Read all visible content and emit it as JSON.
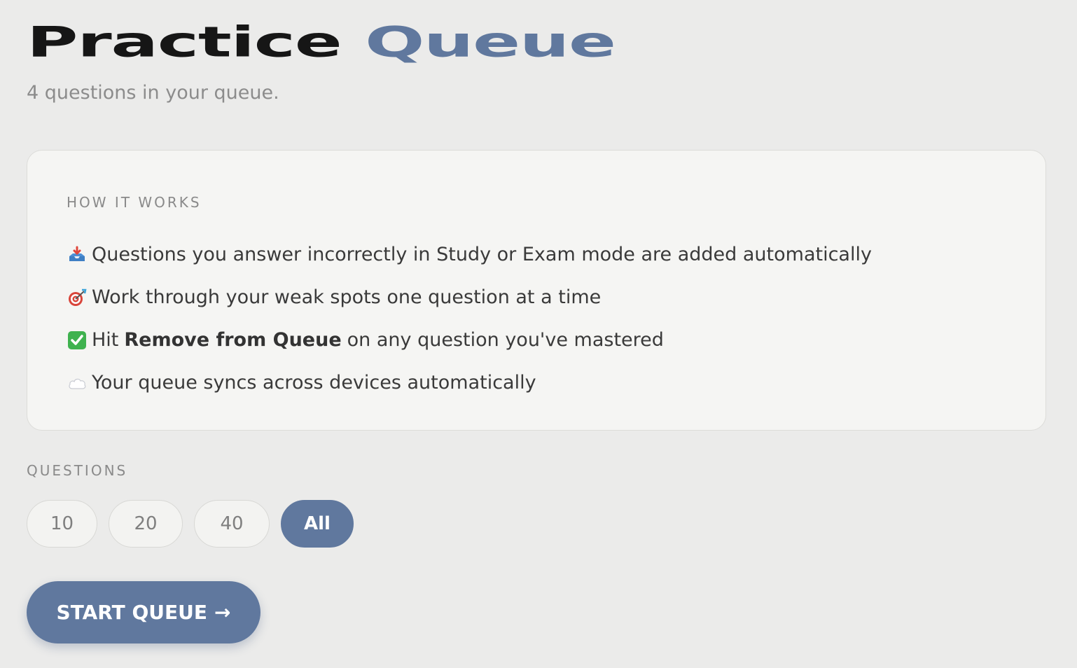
{
  "header": {
    "title_main": "Practice",
    "title_accent": "Queue",
    "subtitle": "4 questions in your queue."
  },
  "how_it_works": {
    "heading": "HOW IT WORKS",
    "items": [
      {
        "icon": "inbox-tray-icon",
        "text": "Questions you answer incorrectly in Study or Exam mode are added automatically"
      },
      {
        "icon": "direct-hit-icon",
        "text": "Work through your weak spots one question at a time"
      },
      {
        "icon": "check-mark-icon",
        "text_before": "Hit",
        "bold": "Remove from Queue",
        "text_after": "on any question you've mastered"
      },
      {
        "icon": "cloud-icon",
        "text": "Your queue syncs across devices automatically"
      }
    ]
  },
  "questions": {
    "label": "QUESTIONS",
    "options": [
      "10",
      "20",
      "40",
      "All"
    ],
    "selected": "All"
  },
  "start_button": {
    "label": "START QUEUE",
    "arrow": "→"
  },
  "colors": {
    "accent": "#60789e",
    "background": "#ebebea",
    "card": "#f5f5f3"
  }
}
